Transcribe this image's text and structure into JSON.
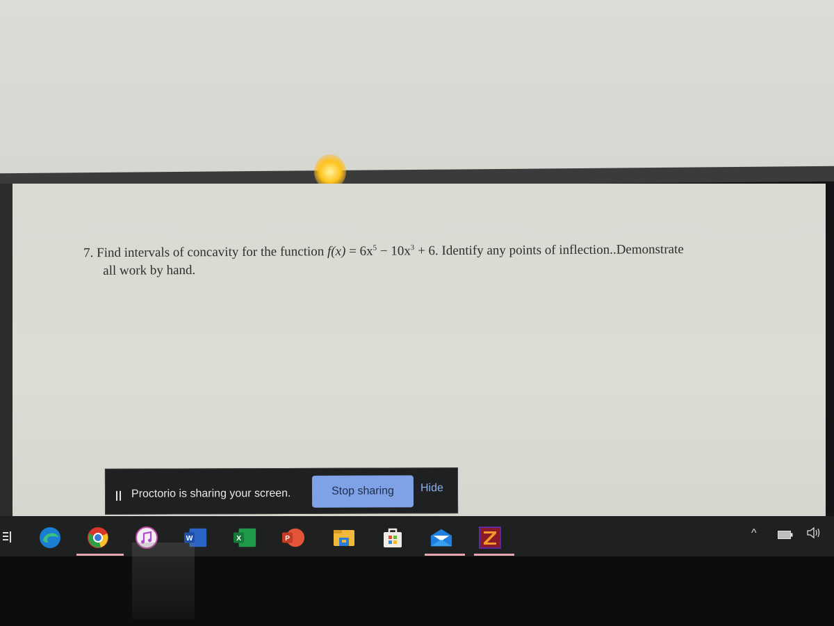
{
  "question": {
    "number": "7.",
    "text_part1": "Find intervals of concavity for the function ",
    "math_f": "f(x)",
    "math_eq": " = 6x",
    "exp1": "5",
    "math_mid": " − 10x",
    "exp2": "3",
    "math_end": " + 6.",
    "text_part2": " Identify any points of inflection..Demonstrate",
    "line2": "all work by hand."
  },
  "share_banner": {
    "message": "Proctorio is sharing your screen.",
    "stop_label": "Stop sharing",
    "hide_label": "Hide"
  },
  "taskbar": {
    "icons": [
      "search-icon",
      "edge-icon",
      "chrome-icon",
      "itunes-icon",
      "word-icon",
      "excel-icon",
      "powerpoint-icon",
      "file-explorer-icon",
      "store-icon",
      "mail-icon",
      "filezilla-icon"
    ],
    "word_letter": "W",
    "excel_letter": "X",
    "powerpoint_letter": "P",
    "filezilla_letter": "Z",
    "tray": {
      "chevron": "^",
      "volume": "🔊"
    },
    "active_apps": [
      "chrome",
      "mail",
      "filezilla"
    ],
    "underline_color": "#e8a7ae"
  }
}
